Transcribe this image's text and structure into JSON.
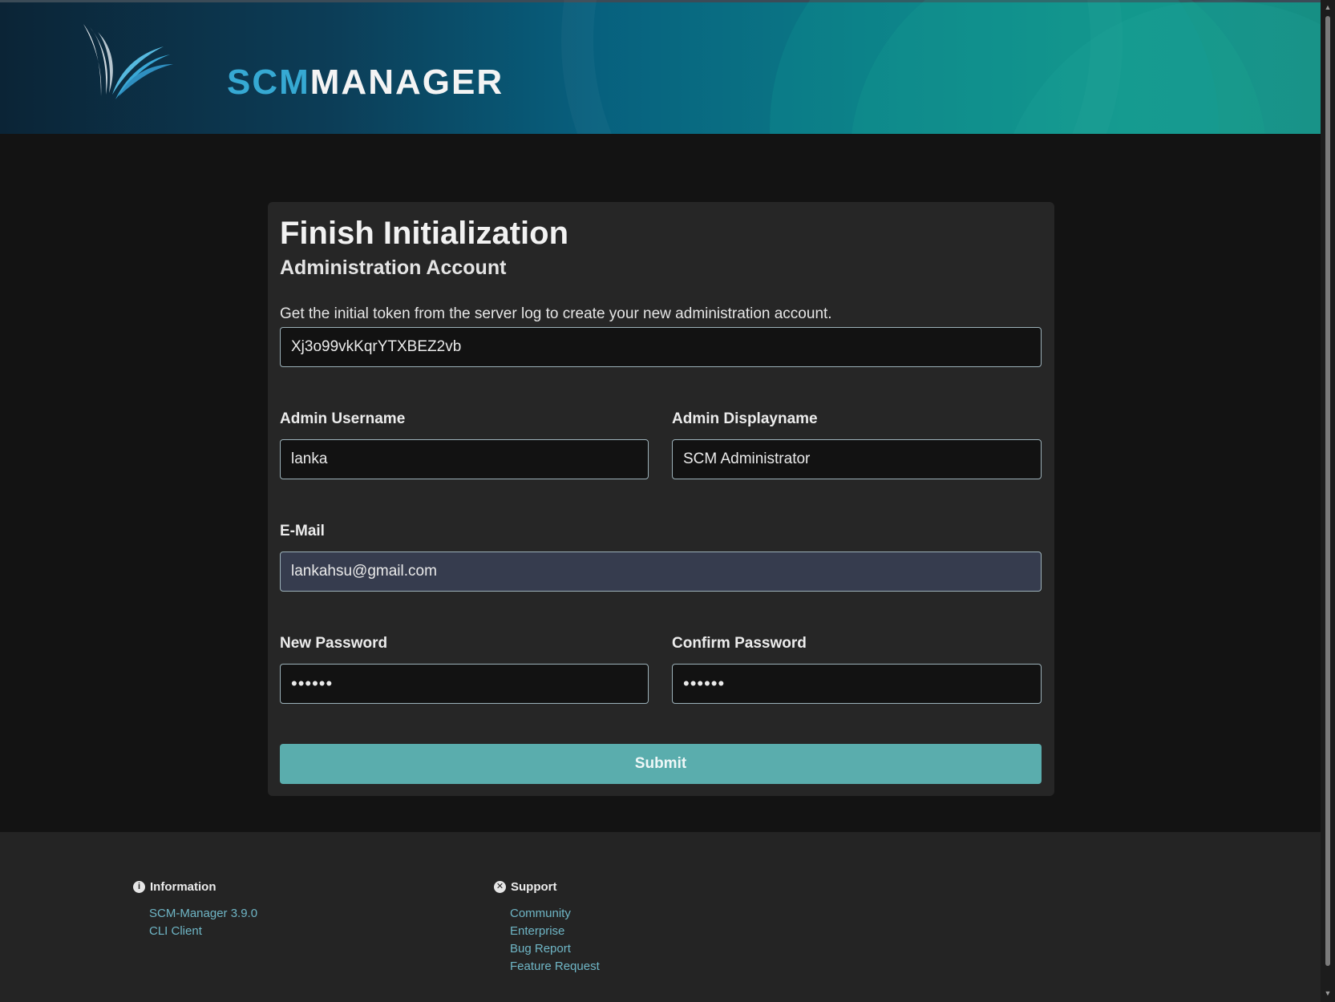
{
  "header": {
    "logo_scm": "SCM",
    "logo_manager": "MANAGER"
  },
  "form": {
    "title": "Finish Initialization",
    "subtitle": "Administration Account",
    "description": "Get the initial token from the server log to create your new administration account.",
    "token": {
      "value": "Xj3o99vkKqrYTXBEZ2vb"
    },
    "username": {
      "label": "Admin Username",
      "value": "lanka"
    },
    "displayname": {
      "label": "Admin Displayname",
      "value": "SCM Administrator"
    },
    "email": {
      "label": "E-Mail",
      "value": "lankahsu@gmail.com"
    },
    "password": {
      "label": "New Password",
      "value": "••••••"
    },
    "confirm_password": {
      "label": "Confirm Password",
      "value": "••••••"
    },
    "submit_label": "Submit"
  },
  "footer": {
    "information": {
      "heading": "Information",
      "icon": "info-icon",
      "links": [
        "SCM-Manager 3.9.0",
        "CLI Client"
      ]
    },
    "support": {
      "heading": "Support",
      "icon": "lifebuoy-icon",
      "links": [
        "Community",
        "Enterprise",
        "Bug Report",
        "Feature Request"
      ]
    }
  },
  "colors": {
    "accent": "#5aadad",
    "link": "#6fb6c6",
    "background": "#131313",
    "card": "#262626"
  }
}
